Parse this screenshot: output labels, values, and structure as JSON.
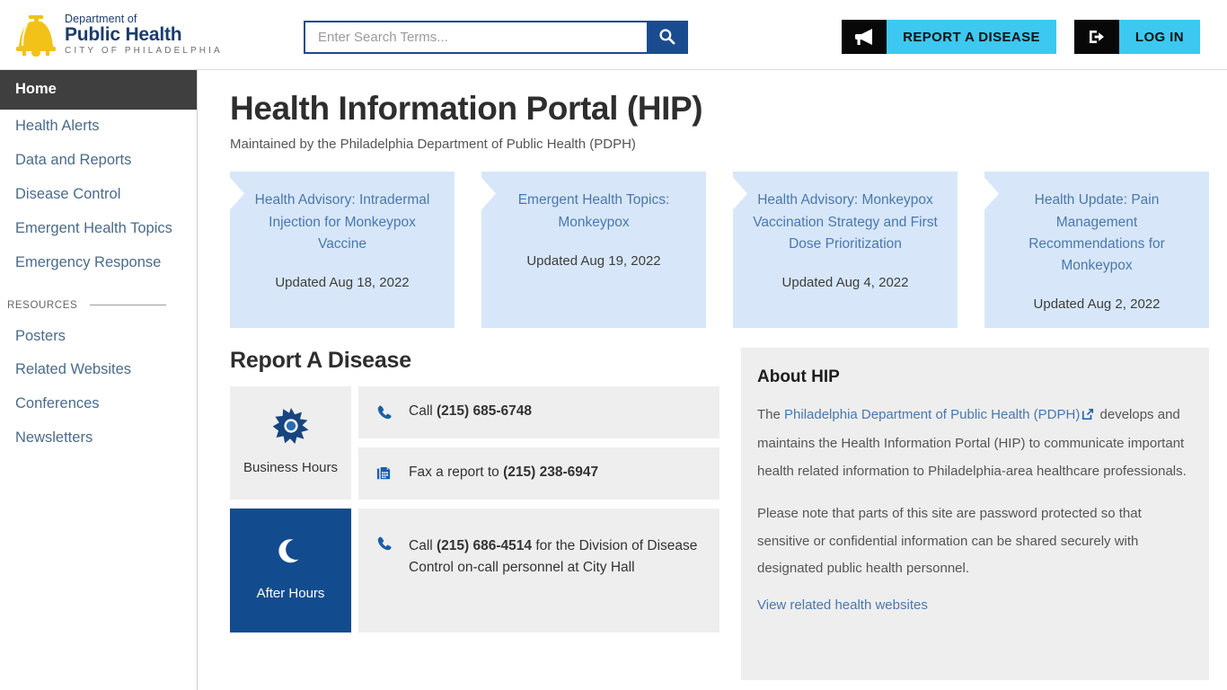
{
  "header": {
    "brand": {
      "dept_line": "Department of",
      "main_line": "Public Health",
      "city_line": "CITY OF PHILADELPHIA",
      "logo_icon": "liberty-bell-icon",
      "logo_color": "#f2c218"
    },
    "search": {
      "placeholder": "Enter Search Terms...",
      "value": "",
      "button_icon": "search-icon"
    },
    "actions": [
      {
        "icon": "megaphone-icon",
        "label": "REPORT A DISEASE"
      },
      {
        "icon": "login-arrow-icon",
        "label": "LOG IN"
      }
    ],
    "accent_color": "#3cc8f0",
    "icon_bg_color": "#080808"
  },
  "sidebar": {
    "items": [
      {
        "label": "Home",
        "active": true
      },
      {
        "label": "Health Alerts",
        "active": false
      },
      {
        "label": "Data and Reports",
        "active": false
      },
      {
        "label": "Disease Control",
        "active": false
      },
      {
        "label": "Emergent Health Topics",
        "active": false
      },
      {
        "label": "Emergency Response",
        "active": false
      }
    ],
    "section_label": "RESOURCES",
    "resources": [
      {
        "label": "Posters"
      },
      {
        "label": "Related Websites"
      },
      {
        "label": "Conferences"
      },
      {
        "label": "Newsletters"
      }
    ],
    "active_bg_color": "#3f3f3f",
    "link_color": "#4a6b8a"
  },
  "main": {
    "title": "Health Information Portal (HIP)",
    "subtitle": "Maintained by the Philadelphia Department of Public Health (PDPH)",
    "cards": [
      {
        "title": "Health Advisory: Intradermal Injection for Monkeypox Vaccine",
        "date": "Updated Aug 18, 2022"
      },
      {
        "title": "Emergent Health Topics: Monkeypox",
        "date": "Updated Aug 19, 2022"
      },
      {
        "title": "Health Advisory: Monkeypox Vaccination Strategy and First Dose Prioritization",
        "date": "Updated Aug 4, 2022"
      },
      {
        "title": "Health Update: Pain Management Recommendations for Monkeypox",
        "date": "Updated Aug 2, 2022"
      }
    ],
    "card_bg_color": "#d7e7f9",
    "card_title_color": "#4a77ad"
  },
  "report": {
    "section_title": "Report A Disease",
    "business": {
      "tile_icon": "sun-icon",
      "tile_label": "Business Hours",
      "rows": [
        {
          "icon": "phone-icon",
          "prefix": "Call ",
          "strong": "(215) 685-6748",
          "suffix": ""
        },
        {
          "icon": "fax-icon",
          "prefix": "Fax a report to ",
          "strong": "(215) 238-6947",
          "suffix": ""
        }
      ]
    },
    "after_hours": {
      "tile_icon": "moon-icon",
      "tile_label": "After Hours",
      "tile_bg_color": "#134c8e",
      "rows": [
        {
          "icon": "phone-icon",
          "prefix": "Call ",
          "strong": "(215) 686-4514",
          "suffix": " for the Division of Disease Control on-call personnel at City Hall"
        }
      ]
    }
  },
  "about": {
    "title": "About HIP",
    "p1_pre": "The ",
    "p1_link": "Philadelphia Department of Public Health (PDPH)",
    "p1_ext_icon": "external-link-icon",
    "p1_post": " develops and maintains the Health Information Portal (HIP) to communicate important health related information to Philadelphia-area healthcare professionals.",
    "p2": "Please note that parts of this site are password protected so that sensitive or confidential information can be shared securely with designated public health personnel.",
    "link": "View related health websites",
    "bg_color": "#eeeeee"
  }
}
